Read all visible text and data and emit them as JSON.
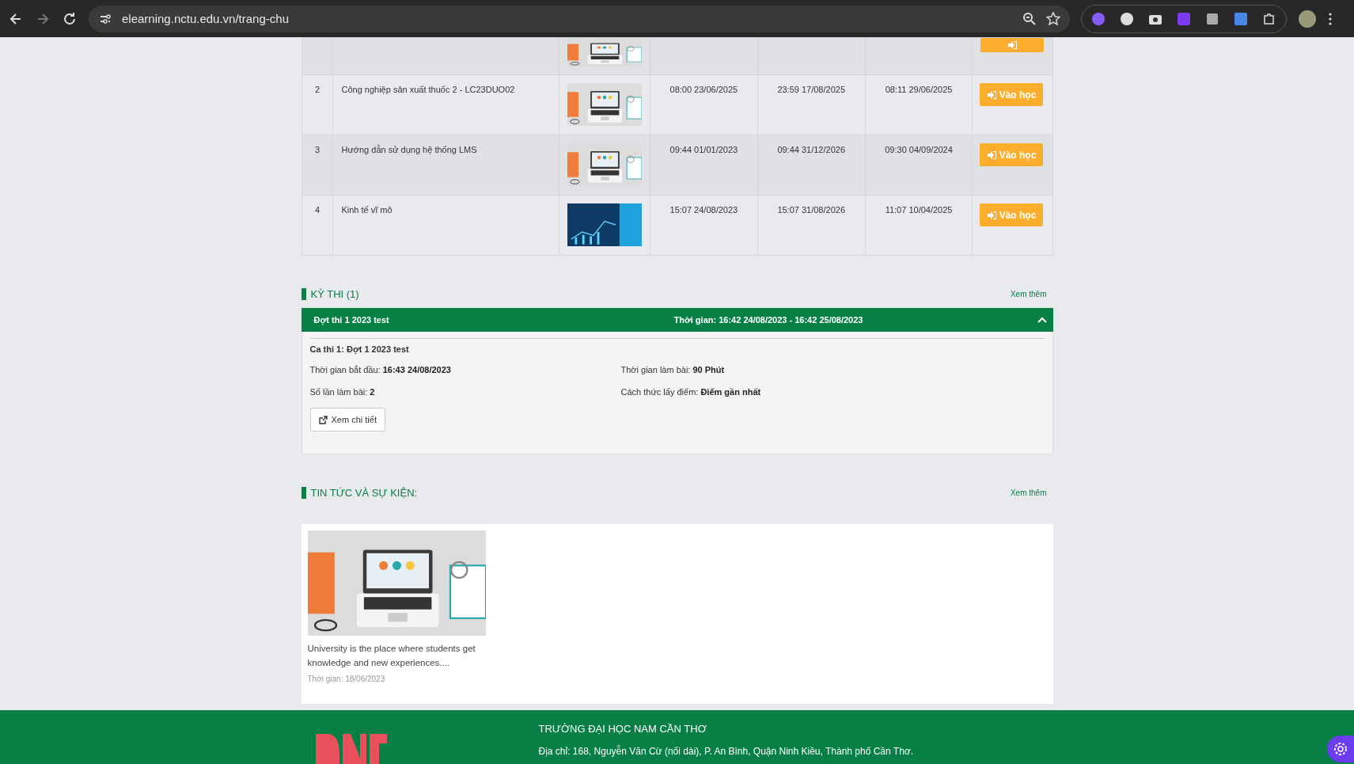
{
  "browser": {
    "url": "elearning.nctu.edu.vn/trang-chu"
  },
  "courses": {
    "partial_row": {
      "thumbnail": {
        "kind": "laptop"
      }
    },
    "rows": [
      {
        "index": "2",
        "name": "Công nghiệp sản xuất thuốc 2 - LC23DUO02",
        "thumbnail": {
          "kind": "laptop"
        },
        "start": "08:00 23/06/2025",
        "end": "23:59 17/08/2025",
        "last_access": "08:11 29/06/2025",
        "button": "Vào học"
      },
      {
        "index": "3",
        "name": "Hướng dẫn sử dụng hệ thống LMS",
        "thumbnail": {
          "kind": "laptop"
        },
        "start": "09:44 01/01/2023",
        "end": "09:44 31/12/2026",
        "last_access": "09:30 04/09/2024",
        "button": "Vào học"
      },
      {
        "index": "4",
        "name": "Kinh tế vĩ mô",
        "thumbnail": {
          "kind": "economics"
        },
        "start": "15:07 24/08/2023",
        "end": "15:07 31/08/2026",
        "last_access": "11:07 10/04/2025",
        "button": "Vào học"
      }
    ]
  },
  "exams": {
    "heading": "KỲ THI (1)",
    "more": "Xem thêm",
    "items": [
      {
        "title": "Đợt thi 1 2023 test",
        "time": "Thời gian: 16:42 24/08/2023 - 16:42 25/08/2023",
        "expanded": true,
        "session": "Ca thi  1: Đợt 1 2023 test",
        "details": [
          "Thời gian bắt đầu: **16:43 24/08/2023**",
          "Thời gian làm bài: **90 Phút**",
          "Số lần làm bài: **2**",
          "Cách thức lấy điểm: **Điểm gần nhất**"
        ],
        "button": "Xem chi tiết"
      }
    ]
  },
  "news": {
    "heading": "TIN TỨC VÀ SỰ KIỆN:",
    "more": "Xem thêm",
    "items": [
      {
        "title": "University is the place where students get knowledge and new experiences....",
        "date": "Thời gian: 18/06/2023"
      }
    ]
  },
  "footer": {
    "title": "TRƯỜNG ĐẠI HỌC NAM CẦN THƠ",
    "address": "Địa chỉ: 168, Nguyễn Văn Cừ (nối dài), P. An Bình, Quận Ninh Kiều, Thành phố Cần Thơ."
  }
}
